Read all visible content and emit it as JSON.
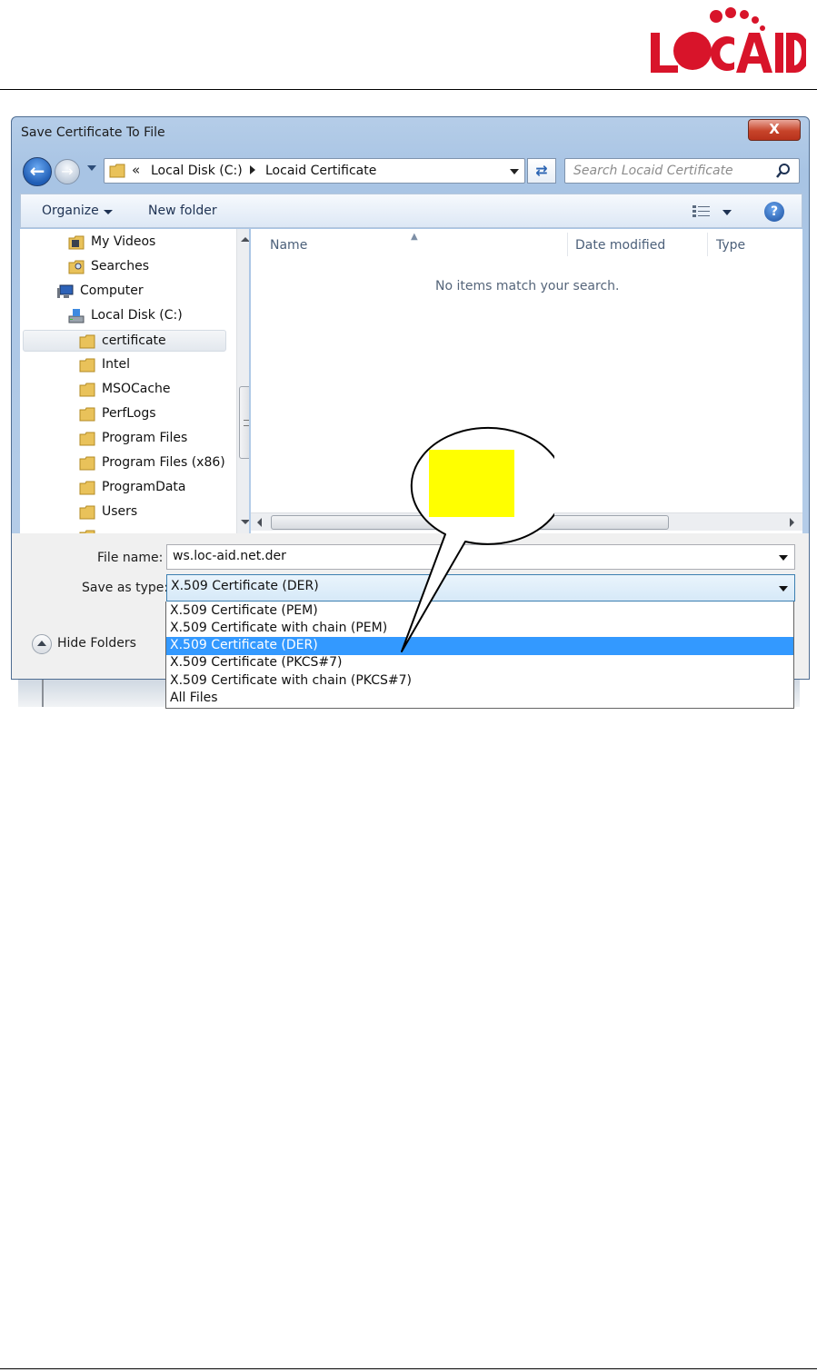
{
  "colors": {
    "accent_red": "#d8142a",
    "logo_text": "#d8142a",
    "selection_blue": "#3399ff",
    "callout_fill": "#ffff00"
  },
  "logo": {
    "text": "LOCAID"
  },
  "window": {
    "title": "Save Certificate To File",
    "close_label": "X"
  },
  "address_bar": {
    "overflow_chevron": "«",
    "crumbs": [
      "Local Disk (C:)",
      "Locaid Certificate"
    ]
  },
  "search": {
    "placeholder": "Search Locaid Certificate"
  },
  "toolbar": {
    "organize_label": "Organize",
    "new_folder_label": "New folder",
    "help_label": "?"
  },
  "navigation_pane": {
    "items": [
      {
        "label": "My Videos",
        "icon": "videos-folder-icon"
      },
      {
        "label": "Searches",
        "icon": "searches-folder-icon"
      },
      {
        "label": "Computer",
        "icon": "computer-icon"
      },
      {
        "label": "Local Disk (C:)",
        "icon": "local-disk-icon"
      },
      {
        "label": "certificate",
        "icon": "folder-icon",
        "selected": true
      },
      {
        "label": "Intel",
        "icon": "folder-icon"
      },
      {
        "label": "MSOCache",
        "icon": "folder-icon"
      },
      {
        "label": "PerfLogs",
        "icon": "folder-icon"
      },
      {
        "label": "Program Files",
        "icon": "folder-icon"
      },
      {
        "label": "Program Files (x86)",
        "icon": "folder-icon"
      },
      {
        "label": "ProgramData",
        "icon": "folder-icon"
      },
      {
        "label": "Users",
        "icon": "folder-icon"
      }
    ]
  },
  "file_list": {
    "columns": [
      "Name",
      "Date modified",
      "Type"
    ],
    "empty_message": "No items match your search."
  },
  "form": {
    "file_name_label": "File name:",
    "file_name_value": "ws.loc-aid.net.der",
    "save_as_type_label": "Save as type:",
    "save_as_type_value": "X.509 Certificate (DER)"
  },
  "hide_folders_label": "Hide Folders",
  "dropdown_options": [
    {
      "label": "X.509 Certificate (PEM)",
      "selected": false
    },
    {
      "label": "X.509 Certificate with chain (PEM)",
      "selected": false
    },
    {
      "label": "X.509 Certificate (DER)",
      "selected": true
    },
    {
      "label": "X.509 Certificate (PKCS#7)",
      "selected": false
    },
    {
      "label": "X.509 Certificate with chain (PKCS#7)",
      "selected": false
    },
    {
      "label": "All Files",
      "selected": false
    }
  ]
}
